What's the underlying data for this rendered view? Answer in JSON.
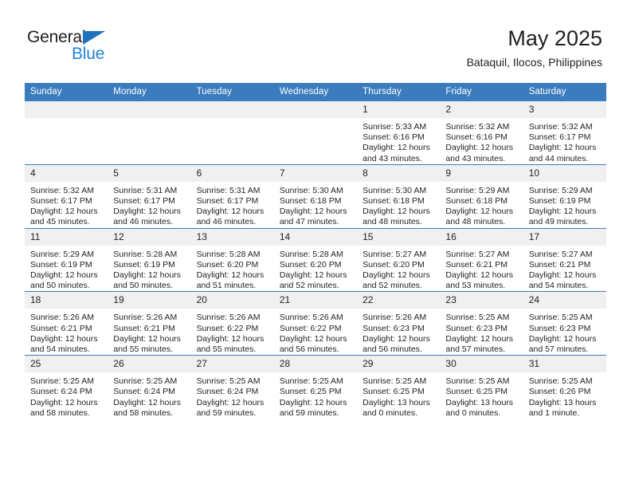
{
  "brand": {
    "name_part1": "General",
    "name_part2": "Blue",
    "accent_color": "#1f84d6",
    "triangle_color": "#1f72bd"
  },
  "header": {
    "title": "May 2025",
    "subtitle": "Bataquil, Ilocos, Philippines"
  },
  "calendar": {
    "header_bg": "#3a7cbe",
    "daynum_bg": "#f0f0f0",
    "weekday_headers": [
      "Sunday",
      "Monday",
      "Tuesday",
      "Wednesday",
      "Thursday",
      "Friday",
      "Saturday"
    ],
    "weeks": [
      [
        {
          "day": "",
          "sunrise": "",
          "sunset": "",
          "daylight_line1": "",
          "daylight_line2": ""
        },
        {
          "day": "",
          "sunrise": "",
          "sunset": "",
          "daylight_line1": "",
          "daylight_line2": ""
        },
        {
          "day": "",
          "sunrise": "",
          "sunset": "",
          "daylight_line1": "",
          "daylight_line2": ""
        },
        {
          "day": "",
          "sunrise": "",
          "sunset": "",
          "daylight_line1": "",
          "daylight_line2": ""
        },
        {
          "day": "1",
          "sunrise": "Sunrise: 5:33 AM",
          "sunset": "Sunset: 6:16 PM",
          "daylight_line1": "Daylight: 12 hours",
          "daylight_line2": "and 43 minutes."
        },
        {
          "day": "2",
          "sunrise": "Sunrise: 5:32 AM",
          "sunset": "Sunset: 6:16 PM",
          "daylight_line1": "Daylight: 12 hours",
          "daylight_line2": "and 43 minutes."
        },
        {
          "day": "3",
          "sunrise": "Sunrise: 5:32 AM",
          "sunset": "Sunset: 6:17 PM",
          "daylight_line1": "Daylight: 12 hours",
          "daylight_line2": "and 44 minutes."
        }
      ],
      [
        {
          "day": "4",
          "sunrise": "Sunrise: 5:32 AM",
          "sunset": "Sunset: 6:17 PM",
          "daylight_line1": "Daylight: 12 hours",
          "daylight_line2": "and 45 minutes."
        },
        {
          "day": "5",
          "sunrise": "Sunrise: 5:31 AM",
          "sunset": "Sunset: 6:17 PM",
          "daylight_line1": "Daylight: 12 hours",
          "daylight_line2": "and 46 minutes."
        },
        {
          "day": "6",
          "sunrise": "Sunrise: 5:31 AM",
          "sunset": "Sunset: 6:17 PM",
          "daylight_line1": "Daylight: 12 hours",
          "daylight_line2": "and 46 minutes."
        },
        {
          "day": "7",
          "sunrise": "Sunrise: 5:30 AM",
          "sunset": "Sunset: 6:18 PM",
          "daylight_line1": "Daylight: 12 hours",
          "daylight_line2": "and 47 minutes."
        },
        {
          "day": "8",
          "sunrise": "Sunrise: 5:30 AM",
          "sunset": "Sunset: 6:18 PM",
          "daylight_line1": "Daylight: 12 hours",
          "daylight_line2": "and 48 minutes."
        },
        {
          "day": "9",
          "sunrise": "Sunrise: 5:29 AM",
          "sunset": "Sunset: 6:18 PM",
          "daylight_line1": "Daylight: 12 hours",
          "daylight_line2": "and 48 minutes."
        },
        {
          "day": "10",
          "sunrise": "Sunrise: 5:29 AM",
          "sunset": "Sunset: 6:19 PM",
          "daylight_line1": "Daylight: 12 hours",
          "daylight_line2": "and 49 minutes."
        }
      ],
      [
        {
          "day": "11",
          "sunrise": "Sunrise: 5:29 AM",
          "sunset": "Sunset: 6:19 PM",
          "daylight_line1": "Daylight: 12 hours",
          "daylight_line2": "and 50 minutes."
        },
        {
          "day": "12",
          "sunrise": "Sunrise: 5:28 AM",
          "sunset": "Sunset: 6:19 PM",
          "daylight_line1": "Daylight: 12 hours",
          "daylight_line2": "and 50 minutes."
        },
        {
          "day": "13",
          "sunrise": "Sunrise: 5:28 AM",
          "sunset": "Sunset: 6:20 PM",
          "daylight_line1": "Daylight: 12 hours",
          "daylight_line2": "and 51 minutes."
        },
        {
          "day": "14",
          "sunrise": "Sunrise: 5:28 AM",
          "sunset": "Sunset: 6:20 PM",
          "daylight_line1": "Daylight: 12 hours",
          "daylight_line2": "and 52 minutes."
        },
        {
          "day": "15",
          "sunrise": "Sunrise: 5:27 AM",
          "sunset": "Sunset: 6:20 PM",
          "daylight_line1": "Daylight: 12 hours",
          "daylight_line2": "and 52 minutes."
        },
        {
          "day": "16",
          "sunrise": "Sunrise: 5:27 AM",
          "sunset": "Sunset: 6:21 PM",
          "daylight_line1": "Daylight: 12 hours",
          "daylight_line2": "and 53 minutes."
        },
        {
          "day": "17",
          "sunrise": "Sunrise: 5:27 AM",
          "sunset": "Sunset: 6:21 PM",
          "daylight_line1": "Daylight: 12 hours",
          "daylight_line2": "and 54 minutes."
        }
      ],
      [
        {
          "day": "18",
          "sunrise": "Sunrise: 5:26 AM",
          "sunset": "Sunset: 6:21 PM",
          "daylight_line1": "Daylight: 12 hours",
          "daylight_line2": "and 54 minutes."
        },
        {
          "day": "19",
          "sunrise": "Sunrise: 5:26 AM",
          "sunset": "Sunset: 6:21 PM",
          "daylight_line1": "Daylight: 12 hours",
          "daylight_line2": "and 55 minutes."
        },
        {
          "day": "20",
          "sunrise": "Sunrise: 5:26 AM",
          "sunset": "Sunset: 6:22 PM",
          "daylight_line1": "Daylight: 12 hours",
          "daylight_line2": "and 55 minutes."
        },
        {
          "day": "21",
          "sunrise": "Sunrise: 5:26 AM",
          "sunset": "Sunset: 6:22 PM",
          "daylight_line1": "Daylight: 12 hours",
          "daylight_line2": "and 56 minutes."
        },
        {
          "day": "22",
          "sunrise": "Sunrise: 5:26 AM",
          "sunset": "Sunset: 6:23 PM",
          "daylight_line1": "Daylight: 12 hours",
          "daylight_line2": "and 56 minutes."
        },
        {
          "day": "23",
          "sunrise": "Sunrise: 5:25 AM",
          "sunset": "Sunset: 6:23 PM",
          "daylight_line1": "Daylight: 12 hours",
          "daylight_line2": "and 57 minutes."
        },
        {
          "day": "24",
          "sunrise": "Sunrise: 5:25 AM",
          "sunset": "Sunset: 6:23 PM",
          "daylight_line1": "Daylight: 12 hours",
          "daylight_line2": "and 57 minutes."
        }
      ],
      [
        {
          "day": "25",
          "sunrise": "Sunrise: 5:25 AM",
          "sunset": "Sunset: 6:24 PM",
          "daylight_line1": "Daylight: 12 hours",
          "daylight_line2": "and 58 minutes."
        },
        {
          "day": "26",
          "sunrise": "Sunrise: 5:25 AM",
          "sunset": "Sunset: 6:24 PM",
          "daylight_line1": "Daylight: 12 hours",
          "daylight_line2": "and 58 minutes."
        },
        {
          "day": "27",
          "sunrise": "Sunrise: 5:25 AM",
          "sunset": "Sunset: 6:24 PM",
          "daylight_line1": "Daylight: 12 hours",
          "daylight_line2": "and 59 minutes."
        },
        {
          "day": "28",
          "sunrise": "Sunrise: 5:25 AM",
          "sunset": "Sunset: 6:25 PM",
          "daylight_line1": "Daylight: 12 hours",
          "daylight_line2": "and 59 minutes."
        },
        {
          "day": "29",
          "sunrise": "Sunrise: 5:25 AM",
          "sunset": "Sunset: 6:25 PM",
          "daylight_line1": "Daylight: 13 hours",
          "daylight_line2": "and 0 minutes."
        },
        {
          "day": "30",
          "sunrise": "Sunrise: 5:25 AM",
          "sunset": "Sunset: 6:25 PM",
          "daylight_line1": "Daylight: 13 hours",
          "daylight_line2": "and 0 minutes."
        },
        {
          "day": "31",
          "sunrise": "Sunrise: 5:25 AM",
          "sunset": "Sunset: 6:26 PM",
          "daylight_line1": "Daylight: 13 hours",
          "daylight_line2": "and 1 minute."
        }
      ]
    ]
  }
}
